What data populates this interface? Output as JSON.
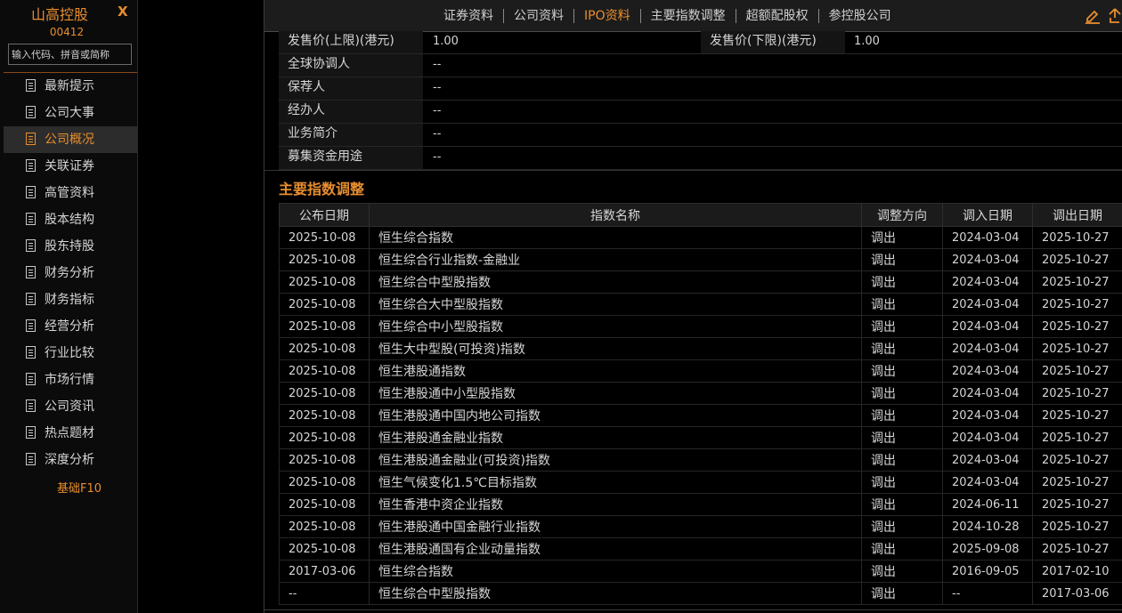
{
  "sidebar": {
    "stock_name": "山高控股",
    "close_label": "X",
    "stock_code": "00412",
    "search_placeholder": "输入代码、拼音或简称",
    "items": [
      {
        "label": "最新提示"
      },
      {
        "label": "公司大事"
      },
      {
        "label": "公司概况",
        "active": true
      },
      {
        "label": "关联证券"
      },
      {
        "label": "高管资料"
      },
      {
        "label": "股本结构"
      },
      {
        "label": "股东持股"
      },
      {
        "label": "财务分析"
      },
      {
        "label": "财务指标"
      },
      {
        "label": "经营分析"
      },
      {
        "label": "行业比较"
      },
      {
        "label": "市场行情"
      },
      {
        "label": "公司资讯"
      },
      {
        "label": "热点题材"
      },
      {
        "label": "深度分析"
      }
    ],
    "footer": "基础F10"
  },
  "topbar": {
    "tabs": [
      {
        "label": "证券资料"
      },
      {
        "label": "公司资料"
      },
      {
        "label": "IPO资料",
        "active": true
      },
      {
        "label": "主要指数调整"
      },
      {
        "label": "超额配股权"
      },
      {
        "label": "参控股公司"
      }
    ],
    "icons": [
      "edit-icon",
      "share-icon"
    ]
  },
  "ipo": {
    "price_upper_label": "发售价(上限)(港元)",
    "price_upper_value": "1.00",
    "price_lower_label": "发售价(下限)(港元)",
    "price_lower_value": "1.00",
    "rows": [
      {
        "label": "全球协调人",
        "value": "--"
      },
      {
        "label": "保荐人",
        "value": "--"
      },
      {
        "label": "经办人",
        "value": "--"
      },
      {
        "label": "业务简介",
        "value": "--"
      },
      {
        "label": "募集资金用途",
        "value": "--"
      }
    ]
  },
  "index_section": {
    "title": "主要指数调整",
    "headers": [
      "公布日期",
      "指数名称",
      "调整方向",
      "调入日期",
      "调出日期"
    ],
    "rows": [
      [
        "2025-10-08",
        "恒生综合指数",
        "调出",
        "2024-03-04",
        "2025-10-27"
      ],
      [
        "2025-10-08",
        "恒生综合行业指数-金融业",
        "调出",
        "2024-03-04",
        "2025-10-27"
      ],
      [
        "2025-10-08",
        "恒生综合中型股指数",
        "调出",
        "2024-03-04",
        "2025-10-27"
      ],
      [
        "2025-10-08",
        "恒生综合大中型股指数",
        "调出",
        "2024-03-04",
        "2025-10-27"
      ],
      [
        "2025-10-08",
        "恒生综合中小型股指数",
        "调出",
        "2024-03-04",
        "2025-10-27"
      ],
      [
        "2025-10-08",
        "恒生大中型股(可投资)指数",
        "调出",
        "2024-03-04",
        "2025-10-27"
      ],
      [
        "2025-10-08",
        "恒生港股通指数",
        "调出",
        "2024-03-04",
        "2025-10-27"
      ],
      [
        "2025-10-08",
        "恒生港股通中小型股指数",
        "调出",
        "2024-03-04",
        "2025-10-27"
      ],
      [
        "2025-10-08",
        "恒生港股通中国内地公司指数",
        "调出",
        "2024-03-04",
        "2025-10-27"
      ],
      [
        "2025-10-08",
        "恒生港股通金融业指数",
        "调出",
        "2024-03-04",
        "2025-10-27"
      ],
      [
        "2025-10-08",
        "恒生港股通金融业(可投资)指数",
        "调出",
        "2024-03-04",
        "2025-10-27"
      ],
      [
        "2025-10-08",
        "恒生气候变化1.5℃目标指数",
        "调出",
        "2024-03-04",
        "2025-10-27"
      ],
      [
        "2025-10-08",
        "恒生香港中资企业指数",
        "调出",
        "2024-06-11",
        "2025-10-27"
      ],
      [
        "2025-10-08",
        "恒生港股通中国金融行业指数",
        "调出",
        "2024-10-28",
        "2025-10-27"
      ],
      [
        "2025-10-08",
        "恒生港股通国有企业动量指数",
        "调出",
        "2025-09-08",
        "2025-10-27"
      ],
      [
        "2017-03-06",
        "恒生综合指数",
        "调出",
        "2016-09-05",
        "2017-02-10"
      ],
      [
        "--",
        "恒生综合中型股指数",
        "调出",
        "--",
        "2017-03-06"
      ]
    ]
  }
}
